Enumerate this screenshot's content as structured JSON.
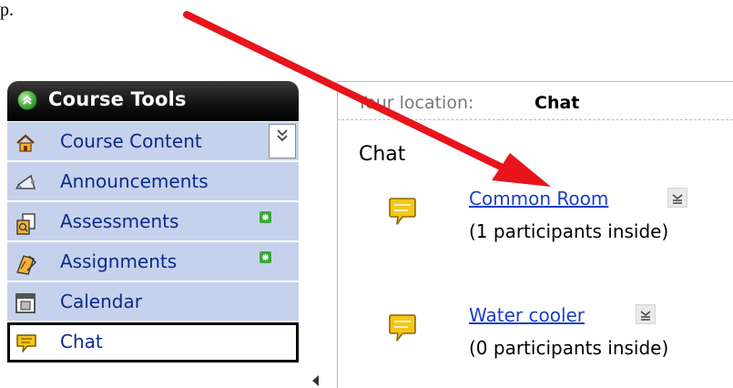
{
  "fragment": {
    "text": "p."
  },
  "sidebar": {
    "title": "Course Tools",
    "items": [
      {
        "label": "Course Content",
        "icon": "home-icon",
        "has_collapse": true
      },
      {
        "label": "Announcements",
        "icon": "megaphone-icon"
      },
      {
        "label": "Assessments",
        "icon": "assessment-icon",
        "new": true
      },
      {
        "label": "Assignments",
        "icon": "assignment-icon",
        "new": true
      },
      {
        "label": "Calendar",
        "icon": "calendar-icon"
      },
      {
        "label": "Chat",
        "icon": "chat-icon",
        "active": true
      }
    ],
    "collapse_glyph": "≚"
  },
  "location": {
    "label": "Your location:",
    "value": "Chat"
  },
  "page_title": "Chat",
  "rooms": [
    {
      "name": "Common Room",
      "participants": "(1 participants inside)"
    },
    {
      "name": "Water cooler",
      "participants": "(0 participants inside)"
    }
  ],
  "colors": {
    "link": "#1a3fc6",
    "menu_bg": "#c6d2ec",
    "annotation_arrow": "#e8141c",
    "header_bg": "#000000",
    "chat_bubble": "#f5c518"
  }
}
